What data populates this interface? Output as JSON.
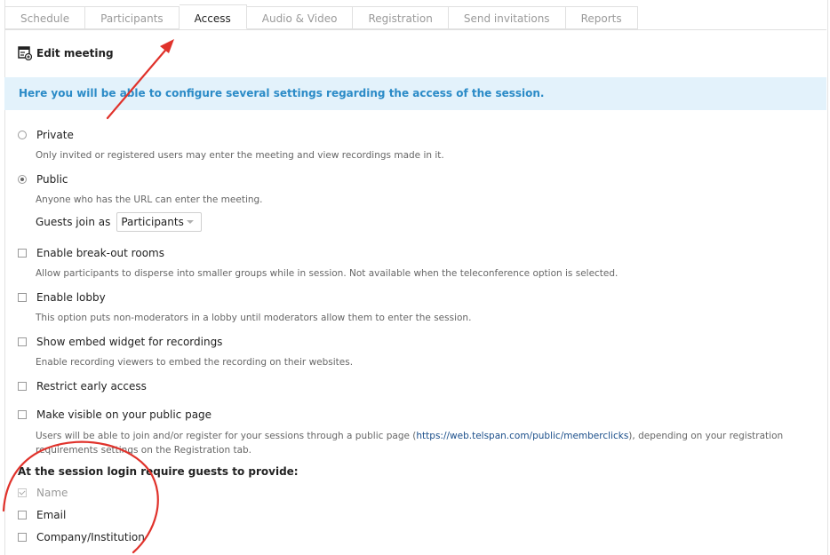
{
  "tabs": [
    "Schedule",
    "Participants",
    "Access",
    "Audio & Video",
    "Registration",
    "Send invitations",
    "Reports"
  ],
  "active_tab": "Access",
  "edit_meeting": "Edit meeting",
  "banner": "Here you will be able to configure several settings regarding the access of the session.",
  "private": {
    "label": "Private",
    "desc": "Only invited or registered users may enter the meeting and view recordings made in it.",
    "selected": false
  },
  "public": {
    "label": "Public",
    "desc": "Anyone who has the URL can enter the meeting.",
    "selected": true,
    "guests_label": "Guests join as",
    "guests_value": "Participants"
  },
  "breakout": {
    "label": "Enable break-out rooms",
    "desc": "Allow participants to disperse into smaller groups while in session. Not available when the teleconference option is selected."
  },
  "lobby": {
    "label": "Enable lobby",
    "desc": "This option puts non-moderators in a lobby until moderators allow them to enter the session."
  },
  "embed": {
    "label": "Show embed widget for recordings",
    "desc": "Enable recording viewers to embed the recording on their websites."
  },
  "early": {
    "label": "Restrict early access"
  },
  "visible": {
    "label": "Make visible on your public page",
    "desc_before": "Users will be able to join and/or register for your sessions through a public page (",
    "link": "https://web.telspan.com/public/memberclicks",
    "desc_after": "), depending on your registration requirements settings on the Registration tab."
  },
  "login_title": "At the session login require guests to provide:",
  "login_fields": [
    {
      "label": "Name",
      "checked": true,
      "disabled": true
    },
    {
      "label": "Email",
      "checked": false,
      "disabled": false
    },
    {
      "label": "Company/Institution",
      "checked": false,
      "disabled": false
    }
  ],
  "annotation_color": "#e0322b",
  "banner_bg": "#e3f2fb",
  "banner_color": "#2b8bc7"
}
